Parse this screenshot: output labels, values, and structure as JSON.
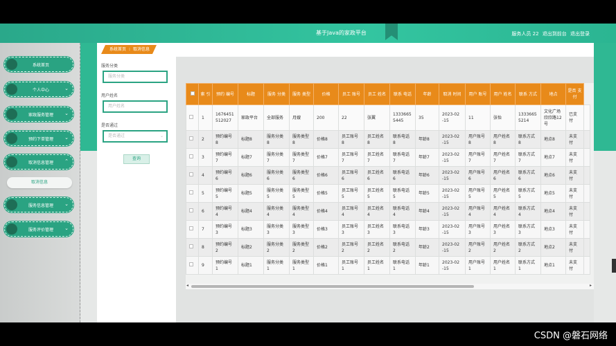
{
  "header": {
    "title": "基于Java的家政平台",
    "user_label": "服务人员 22",
    "back_label": "退出到前台",
    "logout_label": "退出登录"
  },
  "sidebar": {
    "items": [
      {
        "label": "系统首页",
        "chevron": ""
      },
      {
        "label": "个人中心",
        "chevron": "⌄"
      },
      {
        "label": "家政服务管理",
        "chevron": "⌄"
      },
      {
        "label": "预约下单管理",
        "chevron": "⌄"
      },
      {
        "label": "取消信息管理",
        "chevron": "⌃"
      },
      {
        "label": "服务信息管理",
        "chevron": "⌄"
      },
      {
        "label": "服务评价管理",
        "chevron": "⌄"
      }
    ],
    "sub_item": "取消信息"
  },
  "breadcrumb": {
    "home": "系统首页",
    "sep": "⁝",
    "current": "取消信息"
  },
  "filters": {
    "service_category": {
      "label": "服务分类",
      "placeholder": "服务分类"
    },
    "username": {
      "label": "用户姓名",
      "placeholder": "用户姓名"
    },
    "approved": {
      "label": "是否通过",
      "placeholder": "是否通过",
      "arrow": "⌄"
    },
    "query_button": "查询"
  },
  "table": {
    "headers": [
      "索\n引",
      "预约\n编号",
      "标题",
      "服务\n分类",
      "服务\n类型",
      "价格",
      "员工\n账号",
      "员工\n姓名",
      "联系\n电话",
      "年龄",
      "取消\n时间",
      "用户\n账号",
      "用户\n姓名",
      "联系\n方式",
      "地点",
      "是否\n支付"
    ],
    "rows": [
      [
        "1",
        "1676451\n512027",
        "家政平台",
        "全部服务",
        "月嫂",
        "200",
        "22",
        "张翼",
        "1333665\n5445",
        "35",
        "2023-02\n-15",
        "11",
        "张怡",
        "1333665\n5214",
        "文化广场\n欣欣路12\n号",
        "已支付"
      ],
      [
        "2",
        "预约编号\n8",
        "标题8",
        "服务分类\n8",
        "服务类型\n8",
        "价格8",
        "员工账号\n8",
        "员工姓名\n8",
        "联系电话\n8",
        "年龄8",
        "2023-02\n-15",
        "用户账号\n8",
        "用户姓名\n8",
        "联系方式\n8",
        "地点8",
        "未支付"
      ],
      [
        "3",
        "预约编号\n7",
        "标题7",
        "服务分类\n7",
        "服务类型\n7",
        "价格7",
        "员工账号\n7",
        "员工姓名\n7",
        "联系电话\n7",
        "年龄7",
        "2023-02\n-15",
        "用户账号\n7",
        "用户姓名\n7",
        "联系方式\n7",
        "地点7",
        "未支付"
      ],
      [
        "4",
        "预约编号\n6",
        "标题6",
        "服务分类\n6",
        "服务类型\n6",
        "价格6",
        "员工账号\n6",
        "员工姓名\n6",
        "联系电话\n6",
        "年龄6",
        "2023-02\n-15",
        "用户账号\n6",
        "用户姓名\n6",
        "联系方式\n6",
        "地点6",
        "未支付"
      ],
      [
        "5",
        "预约编号\n5",
        "标题5",
        "服务分类\n5",
        "服务类型\n5",
        "价格5",
        "员工账号\n5",
        "员工姓名\n5",
        "联系电话\n5",
        "年龄5",
        "2023-02\n-15",
        "用户账号\n5",
        "用户姓名\n5",
        "联系方式\n5",
        "地点5",
        "未支付"
      ],
      [
        "6",
        "预约编号\n4",
        "标题4",
        "服务分类\n4",
        "服务类型\n4",
        "价格4",
        "员工账号\n4",
        "员工姓名\n4",
        "联系电话\n4",
        "年龄4",
        "2023-02\n-15",
        "用户账号\n4",
        "用户姓名\n4",
        "联系方式\n4",
        "地点4",
        "未支付"
      ],
      [
        "7",
        "预约编号\n3",
        "标题3",
        "服务分类\n3",
        "服务类型\n3",
        "价格3",
        "员工账号\n3",
        "员工姓名\n3",
        "联系电话\n3",
        "年龄3",
        "2023-02\n-15",
        "用户账号\n3",
        "用户姓名\n3",
        "联系方式\n3",
        "地点3",
        "未支付"
      ],
      [
        "8",
        "预约编号\n2",
        "标题2",
        "服务分类\n2",
        "服务类型\n2",
        "价格2",
        "员工账号\n2",
        "员工姓名\n2",
        "联系电话\n2",
        "年龄2",
        "2023-02\n-15",
        "用户账号\n2",
        "用户姓名\n2",
        "联系方式\n2",
        "地点2",
        "未支付"
      ],
      [
        "9",
        "预约编号\n1",
        "标题1",
        "服务分类\n1",
        "服务类型\n1",
        "价格1",
        "员工账号\n1",
        "员工姓名\n1",
        "联系电话\n1",
        "年龄1",
        "2023-02\n-15",
        "用户账号\n1",
        "用户姓名\n1",
        "联系方式\n1",
        "地点1",
        "未支付"
      ]
    ]
  },
  "scrollbar": {
    "left": "◂",
    "right": "▸"
  },
  "watermark": "CSDN @磐石网络",
  "colors": {
    "teal": "#2aa382",
    "orange": "#e88a1a"
  }
}
